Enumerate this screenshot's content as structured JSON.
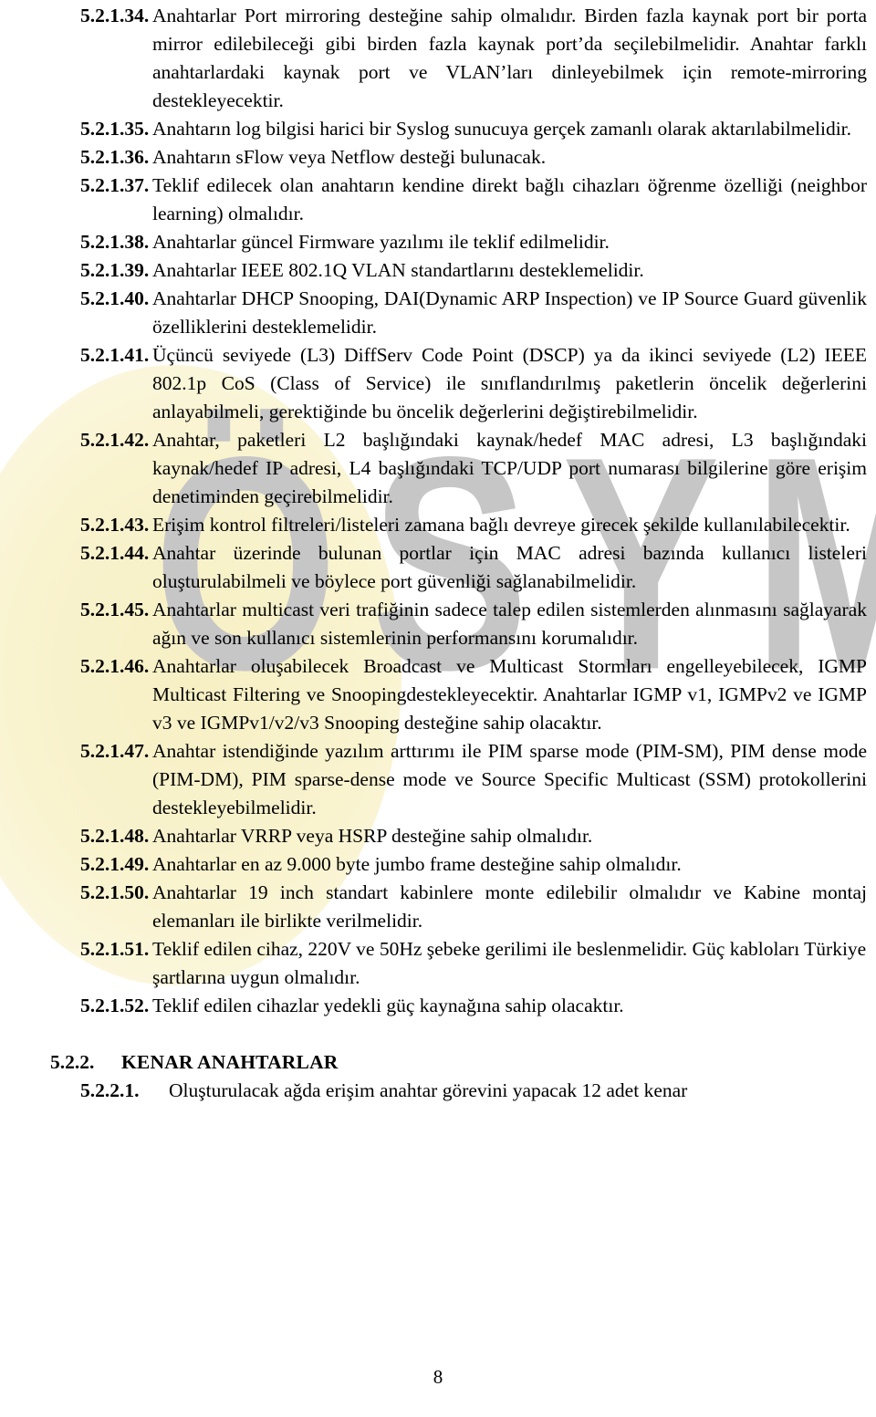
{
  "document": {
    "watermark_blob_color": "#f8f2cb",
    "watermark_text": "ÖSYM",
    "watermark_text_color": "#c6c6c6",
    "page_number": "8"
  },
  "clauses": [
    {
      "number": "5.2.1.34.",
      "text": "Anahtarlar Port mirroring desteğine sahip olmalıdır. Birden fazla kaynak port bir porta mirror edilebileceği gibi birden fazla kaynak port’da seçilebilmelidir. Anahtar farklı anahtarlardaki kaynak port ve VLAN’ları dinleyebilmek için remote-mirroring destekleyecektir."
    },
    {
      "number": "5.2.1.35.",
      "text": "Anahtarın log bilgisi harici bir Syslog sunucuya gerçek zamanlı olarak aktarılabilmelidir."
    },
    {
      "number": "5.2.1.36.",
      "text": "Anahtarın sFlow veya Netflow desteği bulunacak."
    },
    {
      "number": "5.2.1.37.",
      "text": "Teklif edilecek olan anahtarın kendine direkt bağlı cihazları öğrenme özelliği (neighbor learning) olmalıdır."
    },
    {
      "number": "5.2.1.38.",
      "text": "Anahtarlar güncel Firmware yazılımı ile teklif edilmelidir."
    },
    {
      "number": "5.2.1.39.",
      "text": "Anahtarlar IEEE 802.1Q VLAN standartlarını desteklemelidir."
    },
    {
      "number": "5.2.1.40.",
      "text": "Anahtarlar DHCP Snooping, DAI(Dynamic ARP Inspection) ve IP Source Guard güvenlik özelliklerini desteklemelidir."
    },
    {
      "number": "5.2.1.41.",
      "text": "Üçüncü seviyede (L3) DiffServ Code Point (DSCP) ya da ikinci seviyede (L2) IEEE 802.1p CoS (Class of Service) ile sınıflandırılmış paketlerin öncelik değerlerini anlayabilmeli, gerektiğinde bu öncelik değerlerini değiştirebilmelidir."
    },
    {
      "number": "5.2.1.42.",
      "text": "Anahtar, paketleri L2 başlığındaki kaynak/hedef MAC adresi, L3 başlığındaki kaynak/hedef IP adresi, L4 başlığındaki TCP/UDP port numarası bilgilerine göre erişim denetiminden geçirebilmelidir."
    },
    {
      "number": "5.2.1.43.",
      "text": "Erişim kontrol filtreleri/listeleri zamana bağlı devreye girecek şekilde kullanılabilecektir."
    },
    {
      "number": "5.2.1.44.",
      "text": "Anahtar üzerinde bulunan portlar için MAC adresi bazında kullanıcı listeleri oluşturulabilmeli ve böylece port güvenliği sağlanabilmelidir."
    },
    {
      "number": "5.2.1.45.",
      "text": "Anahtarlar multicast veri trafiğinin sadece talep edilen sistemlerden alınmasını sağlayarak ağın ve son kullanıcı sistemlerinin performansını korumalıdır."
    },
    {
      "number": "5.2.1.46.",
      "text": "Anahtarlar oluşabilecek Broadcast ve Multicast Stormları engelleyebilecek, IGMP Multicast Filtering ve Snoopingdestekleyecektir. Anahtarlar IGMP v1, IGMPv2 ve IGMP v3 ve IGMPv1/v2/v3 Snooping desteğine sahip olacaktır."
    },
    {
      "number": "5.2.1.47.",
      "text": "Anahtar istendiğinde yazılım arttırımı ile PIM sparse mode (PIM-SM), PIM dense mode (PIM-DM), PIM sparse-dense mode ve Source Specific Multicast (SSM) protokollerini destekleyebilmelidir."
    },
    {
      "number": "5.2.1.48.",
      "text": "Anahtarlar VRRP veya HSRP desteğine sahip olmalıdır."
    },
    {
      "number": "5.2.1.49.",
      "text": "Anahtarlar en az 9.000 byte jumbo frame desteğine sahip olmalıdır."
    },
    {
      "number": "5.2.1.50.",
      "text": "Anahtarlar 19 inch standart kabinlere monte edilebilir olmalıdır ve Kabine montaj elemanları ile birlikte verilmelidir."
    },
    {
      "number": "5.2.1.51.",
      "text": "Teklif edilen cihaz, 220V ve 50Hz şebeke gerilimi ile beslenmelidir. Güç kabloları Türkiye şartlarına uygun olmalıdır."
    },
    {
      "number": "5.2.1.52.",
      "text": "Teklif edilen cihazlar yedekli güç kaynağına sahip olacaktır."
    }
  ],
  "section": {
    "number": "5.2.2.",
    "title": "KENAR ANAHTARLAR"
  },
  "subclauses": [
    {
      "number": "5.2.2.1.",
      "text": "Oluşturulacak ağda erişim anahtar görevini yapacak 12 adet kenar"
    }
  ]
}
